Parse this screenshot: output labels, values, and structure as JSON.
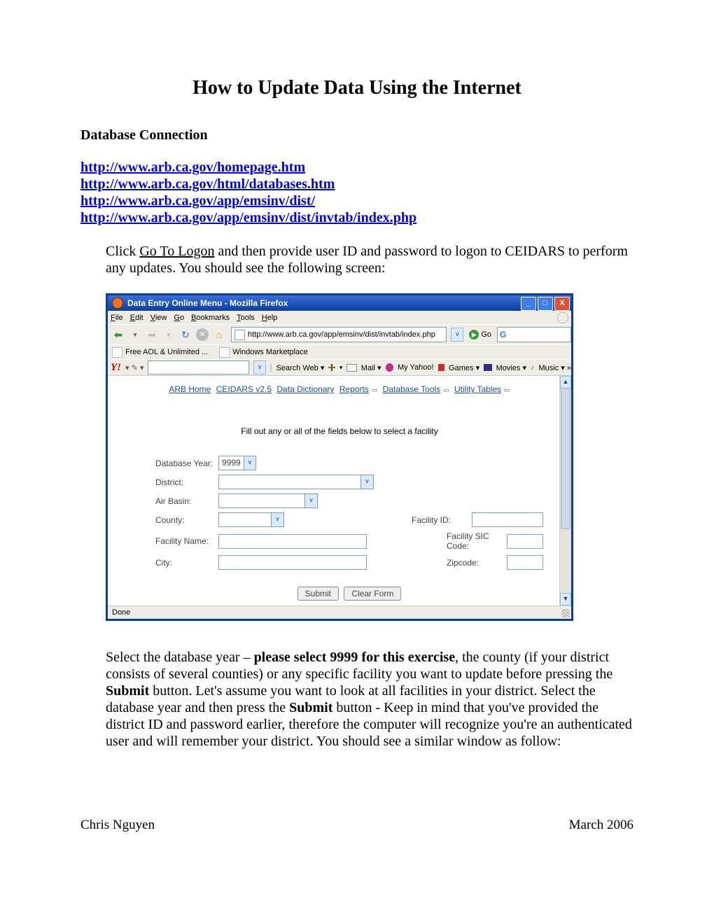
{
  "doc": {
    "title": "How to Update Data Using the Internet",
    "section": "Database Connection",
    "links": [
      "http://www.arb.ca.gov/homepage.htm",
      "http://www.arb.ca.gov/html/databases.htm",
      "http://www.arb.ca.gov/app/emsinv/dist/",
      "http://www.arb.ca.gov/app/emsinv/dist/invtab/index.php"
    ],
    "p1a": "Click ",
    "p1link": "Go To Logon",
    "p1b": " and then provide user ID and password to logon to CEIDARS to perform any updates.  You should see the following screen:",
    "p2": "Select the database year – please select 9999 for this exercise, the county (if your district consists of several counties) or any specific facility you want to update before pressing the Submit button.  Let's assume you want to look at all facilities in your district.  Select the database year and then press the Submit button - Keep in mind that you've provided the district ID and password earlier, therefore the computer will recognize you're an authenticated user and will remember your district.  You should see a similar window as follow:",
    "footer_left": "Chris Nguyen",
    "footer_right": "March 2006"
  },
  "window": {
    "title": "Data Entry Online Menu - Mozilla Firefox",
    "menus": [
      "File",
      "Edit",
      "View",
      "Go",
      "Bookmarks",
      "Tools",
      "Help"
    ],
    "url": "http://www.arb.ca.gov/app/emsinv/dist/invtab/index.php",
    "go_label": "Go",
    "bookmarks": [
      "Free AOL & Unlimited ...",
      "Windows Marketplace"
    ],
    "yahoo": {
      "search_label": "Search Web",
      "mail": "Mail",
      "my": "My Yahoo!",
      "games": "Games",
      "movies": "Movies",
      "music": "Music"
    },
    "nav": {
      "arb_home": "ARB Home",
      "ceidars": "CEIDARS v2.5",
      "data_dict": "Data Dictionary",
      "reports": "Reports",
      "db_tools": "Database Tools",
      "util_tables": "Utility Tables"
    },
    "instruction": "Fill out any or all of the fields below to select a facility",
    "form": {
      "db_year_label": "Database Year:",
      "db_year_value": "9999",
      "district_label": "District:",
      "airbasin_label": "Air Basin:",
      "county_label": "County:",
      "facid_label": "Facility ID:",
      "facname_label": "Facility Name:",
      "sic_label": "Facility SIC Code:",
      "city_label": "City:",
      "zip_label": "Zipcode:",
      "submit": "Submit",
      "clear": "Clear Form"
    },
    "status": "Done"
  }
}
